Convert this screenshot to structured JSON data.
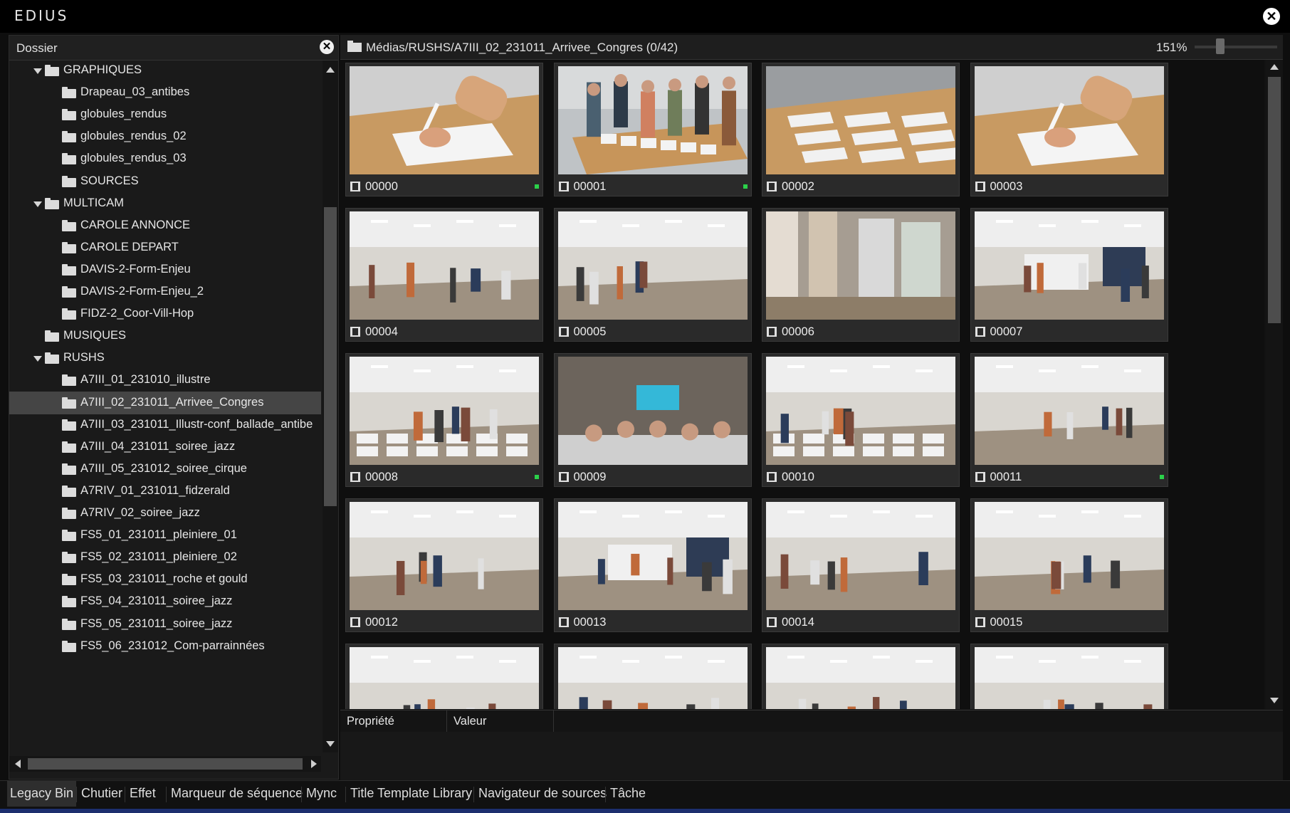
{
  "app": {
    "title": "EDIUS",
    "close_symbol": "✕"
  },
  "folder_panel": {
    "header": "Dossier",
    "close_symbol": "✕",
    "tree": [
      {
        "label": "GRAPHIQUES",
        "level": 0,
        "expanded": true
      },
      {
        "label": "Drapeau_03_antibes",
        "level": 1
      },
      {
        "label": "globules_rendus",
        "level": 1
      },
      {
        "label": "globules_rendus_02",
        "level": 1
      },
      {
        "label": "globules_rendus_03",
        "level": 1
      },
      {
        "label": "SOURCES",
        "level": 1
      },
      {
        "label": "MULTICAM",
        "level": 0,
        "expanded": true
      },
      {
        "label": "CAROLE ANNONCE",
        "level": 1
      },
      {
        "label": "CAROLE DEPART",
        "level": 1
      },
      {
        "label": "DAVIS-2-Form-Enjeu",
        "level": 1
      },
      {
        "label": "DAVIS-2-Form-Enjeu_2",
        "level": 1
      },
      {
        "label": "FIDZ-2_Coor-Vill-Hop",
        "level": 1
      },
      {
        "label": "MUSIQUES",
        "level": 0
      },
      {
        "label": "RUSHS",
        "level": 0,
        "expanded": true
      },
      {
        "label": "A7III_01_231010_illustre",
        "level": 1
      },
      {
        "label": "A7III_02_231011_Arrivee_Congres",
        "level": 1,
        "selected": true
      },
      {
        "label": "A7III_03_231011_Illustr-conf_ballade_antibe",
        "level": 1
      },
      {
        "label": "A7III_04_231011_soiree_jazz",
        "level": 1
      },
      {
        "label": "A7III_05_231012_soiree_cirque",
        "level": 1
      },
      {
        "label": "A7RIV_01_231011_fidzerald",
        "level": 1
      },
      {
        "label": "A7RIV_02_soiree_jazz",
        "level": 1
      },
      {
        "label": "FS5_01_231011_pleiniere_01",
        "level": 1
      },
      {
        "label": "FS5_02_231011_pleiniere_02",
        "level": 1
      },
      {
        "label": "FS5_03_231011_roche et gould",
        "level": 1
      },
      {
        "label": "FS5_04_231011_soiree_jazz",
        "level": 1
      },
      {
        "label": "FS5_05_231011_soiree_jazz",
        "level": 1
      },
      {
        "label": "FS5_06_231012_Com-parrainnées",
        "level": 1
      }
    ]
  },
  "browser": {
    "path": "Médias/RUSHS/A7III_02_231011_Arrivee_Congres (0/42)",
    "zoom": "151%",
    "zoom_fraction": 0.25,
    "clips": [
      {
        "name": "00000",
        "scene": "sign",
        "flag": true
      },
      {
        "name": "00001",
        "scene": "table",
        "flag": true
      },
      {
        "name": "00002",
        "scene": "papers",
        "flag": false
      },
      {
        "name": "00003",
        "scene": "sign",
        "flag": false
      },
      {
        "name": "00004",
        "scene": "hall",
        "flag": false
      },
      {
        "name": "00005",
        "scene": "hall",
        "flag": false
      },
      {
        "name": "00006",
        "scene": "posters",
        "flag": false
      },
      {
        "name": "00007",
        "scene": "stand",
        "flag": false
      },
      {
        "name": "00008",
        "scene": "chairs",
        "flag": true
      },
      {
        "name": "00009",
        "scene": "screen",
        "flag": false
      },
      {
        "name": "00010",
        "scene": "chairs",
        "flag": false
      },
      {
        "name": "00011",
        "scene": "hall",
        "flag": true
      },
      {
        "name": "00012",
        "scene": "hall",
        "flag": false
      },
      {
        "name": "00013",
        "scene": "stand",
        "flag": false
      },
      {
        "name": "00014",
        "scene": "hall",
        "flag": false
      },
      {
        "name": "00015",
        "scene": "hall",
        "flag": false
      },
      {
        "name": "",
        "scene": "hall",
        "flag": false
      },
      {
        "name": "",
        "scene": "hall",
        "flag": false
      },
      {
        "name": "",
        "scene": "hall",
        "flag": false
      },
      {
        "name": "",
        "scene": "hall",
        "flag": false
      }
    ]
  },
  "properties": {
    "col_property": "Propriété",
    "col_value": "Valeur"
  },
  "tabs": [
    "Legacy Bin",
    "Chutier",
    "Effet",
    "Marqueur de séquence",
    "Mync",
    "Title Template Library",
    "Navigateur de sources",
    "Tâche"
  ],
  "active_tab": "Legacy Bin",
  "colors": {
    "accent_green": "#2bd14a",
    "bottom_bar": "#1c2f6e",
    "selected_row": "#454545"
  }
}
